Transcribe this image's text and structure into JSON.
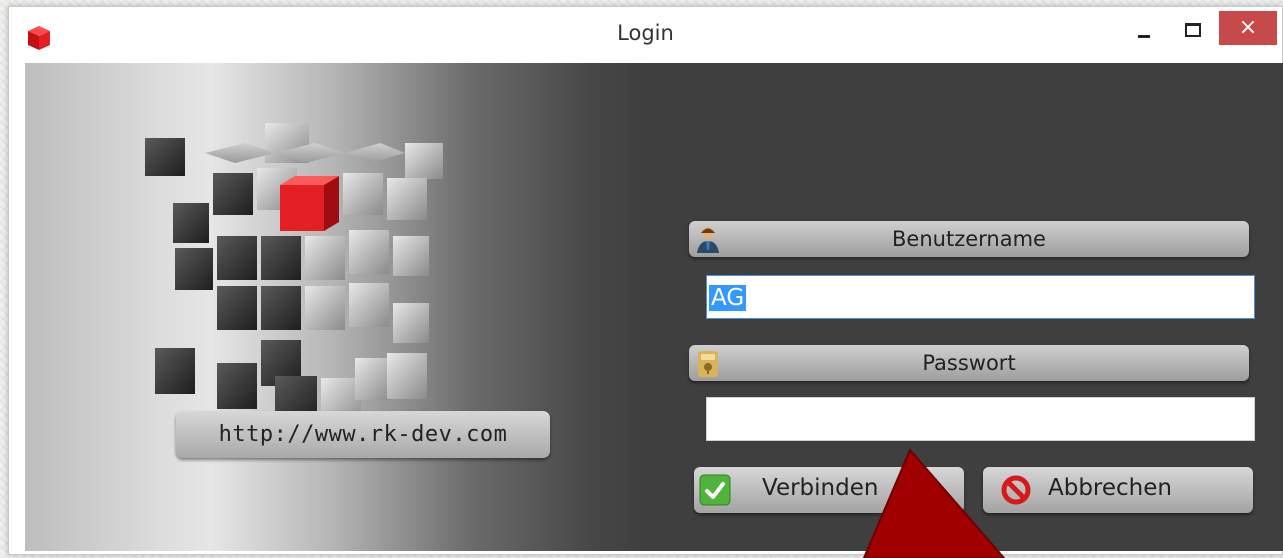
{
  "window": {
    "title": "Login",
    "controls": [
      "minimize",
      "maximize",
      "close"
    ],
    "close_glyph": "×"
  },
  "left_panel": {
    "url_label": "http://www.rk-dev.com",
    "logo": "cube-logo-icon"
  },
  "form": {
    "username_label": "Benutzername",
    "username_icon": "user-icon",
    "username_value": "AG",
    "password_label": "Passwort",
    "password_icon": "key-icon",
    "password_value": ""
  },
  "buttons": {
    "connect_label": "Verbinden",
    "connect_icon": "checkmark-icon",
    "cancel_label": "Abbrechen",
    "cancel_icon": "stop-icon"
  },
  "colors": {
    "accent_red": "#e41e25",
    "close_button": "#c8494a",
    "selection": "#3399ff",
    "annotation_arrow": "#a00000"
  }
}
